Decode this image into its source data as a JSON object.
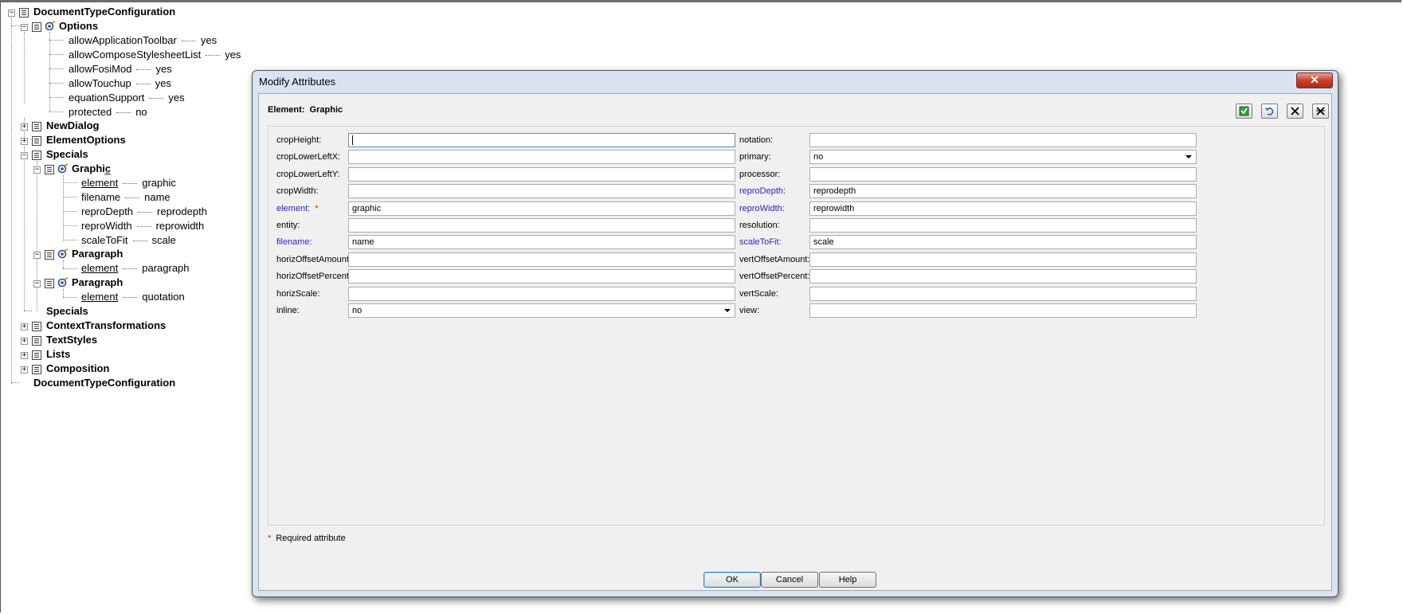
{
  "tree": {
    "root_label": "DocumentTypeConfiguration",
    "options_label": "Options",
    "options_attrs": [
      {
        "name": "allowApplicationToolbar",
        "value": "yes"
      },
      {
        "name": "allowComposeStylesheetList",
        "value": "yes"
      },
      {
        "name": "allowFosiMod",
        "value": "yes"
      },
      {
        "name": "allowTouchup",
        "value": "yes"
      },
      {
        "name": "equationSupport",
        "value": "yes"
      },
      {
        "name": "protected",
        "value": "no"
      }
    ],
    "newdialog_label": "NewDialog",
    "elementoptions_label": "ElementOptions",
    "specials_label": "Specials",
    "graphic_label": "Graphic",
    "graphic_attrs": [
      {
        "name": "element",
        "value": "graphic"
      },
      {
        "name": "filename",
        "value": "name"
      },
      {
        "name": "reproDepth",
        "value": "reprodepth"
      },
      {
        "name": "reproWidth",
        "value": "reprowidth"
      },
      {
        "name": "scaleToFit",
        "value": "scale"
      }
    ],
    "paragraph1_label": "Paragraph",
    "paragraph1_attr": {
      "name": "element",
      "value": "paragraph"
    },
    "paragraph2_label": "Paragraph",
    "paragraph2_attr": {
      "name": "element",
      "value": "quotation"
    },
    "specials_end_label": "Specials",
    "contexttransformations_label": "ContextTransformations",
    "textstyles_label": "TextStyles",
    "lists_label": "Lists",
    "composition_label": "Composition",
    "root_end_label": "DocumentTypeConfiguration"
  },
  "dialog": {
    "title": "Modify Attributes",
    "close_glyph": "✕",
    "element_prefix": "Element:",
    "element_name": "Graphic",
    "required_star": "*",
    "required_note": "Required attribute",
    "left_fields": [
      {
        "label": "cropHeight:",
        "value": "",
        "required": false
      },
      {
        "label": "cropLowerLeftX:",
        "value": "",
        "required": false
      },
      {
        "label": "cropLowerLeftY:",
        "value": "",
        "required": false
      },
      {
        "label": "cropWidth:",
        "value": "",
        "required": false
      },
      {
        "label": "element:",
        "value": "graphic",
        "required": true
      },
      {
        "label": "entity:",
        "value": "",
        "required": false
      },
      {
        "label": "filename:",
        "value": "name",
        "required": false
      },
      {
        "label": "horizOffsetAmount:",
        "value": "",
        "required": false
      },
      {
        "label": "horizOffsetPercent:",
        "value": "",
        "required": false
      },
      {
        "label": "horizScale:",
        "value": "",
        "required": false
      },
      {
        "label": "inline:",
        "value": "no",
        "required": false
      }
    ],
    "right_fields": [
      {
        "label": "notation:",
        "value": ""
      },
      {
        "label": "primary:",
        "value": "no"
      },
      {
        "label": "processor:",
        "value": ""
      },
      {
        "label": "reproDepth:",
        "value": "reprodepth"
      },
      {
        "label": "reproWidth:",
        "value": "reprowidth"
      },
      {
        "label": "resolution:",
        "value": ""
      },
      {
        "label": "scaleToFit:",
        "value": "scale"
      },
      {
        "label": "vertOffsetAmount:",
        "value": ""
      },
      {
        "label": "vertOffsetPercent:",
        "value": ""
      },
      {
        "label": "vertScale:",
        "value": ""
      },
      {
        "label": "view:",
        "value": ""
      }
    ],
    "buttons": {
      "ok": "OK",
      "cancel": "Cancel",
      "help": "Help"
    },
    "colors": {
      "required_label": "#2626c8",
      "required_star": "#e02020",
      "title_bar": "#d8e4f1",
      "close_button": "#c7412b"
    }
  }
}
